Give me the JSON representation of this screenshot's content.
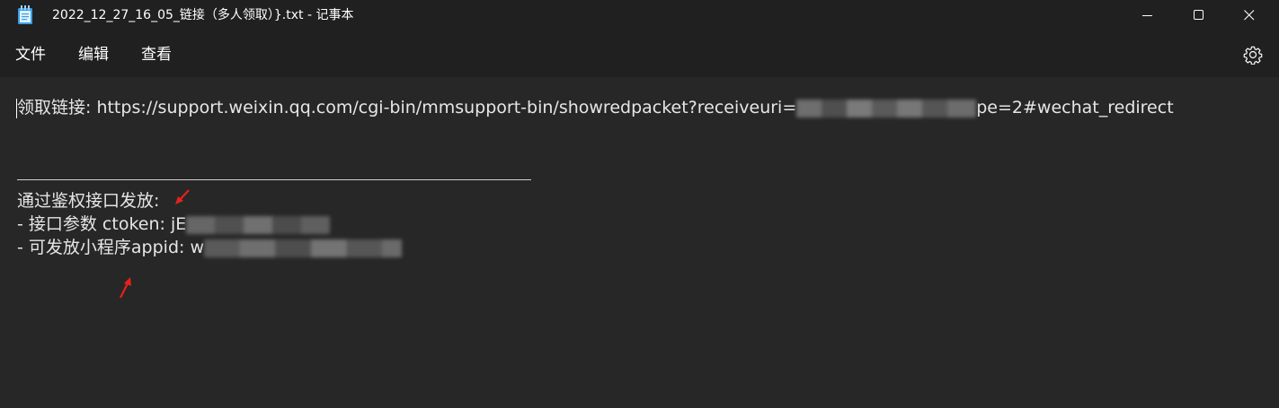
{
  "window": {
    "title": "2022_12_27_16_05_链接（多人领取）}.txt - 记事本",
    "app_icon": "notepad-icon",
    "controls": [
      "minimize-icon",
      "maximize-icon",
      "close-icon"
    ]
  },
  "menu": {
    "file": "文件",
    "edit": "编辑",
    "view": "查看",
    "settings_icon": "gear-icon"
  },
  "document": {
    "line1_prefix": "领取链接: https://support.weixin.qq.com/cgi-bin/mmsupport-bin/showredpacket?receiveuri=",
    "line1_suffix": "pe=2#wechat_redirect",
    "line4": "通过鉴权接口发放:",
    "line5_prefix": "- 接口参数 ctoken: jE",
    "line6_prefix": "- 可发放小程序appid: w"
  },
  "colors": {
    "background": "#272727",
    "chrome": "#202020",
    "text": "#e6e6e6",
    "annotation_arrow": "#e5221c"
  }
}
